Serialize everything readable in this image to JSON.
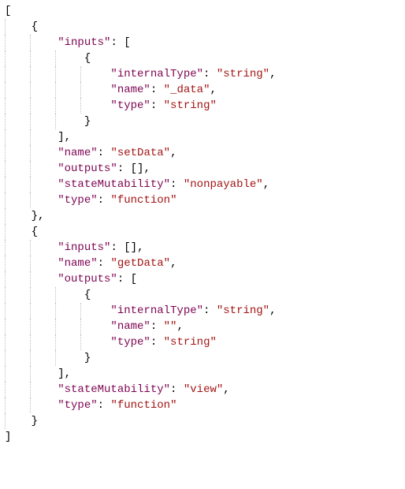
{
  "colors": {
    "key": "#7D0552",
    "string": "#A31515",
    "punct": "#000000",
    "brace": "#000000",
    "guide": "#c0c0c0"
  },
  "indentChar": "    ",
  "json_abi": [
    {
      "inputs": [
        {
          "internalType": "string",
          "name": "_data",
          "type": "string"
        }
      ],
      "name": "setData",
      "outputs": [],
      "stateMutability": "nonpayable",
      "type": "function"
    },
    {
      "inputs": [],
      "name": "getData",
      "outputs": [
        {
          "internalType": "string",
          "name": "",
          "type": "string"
        }
      ],
      "stateMutability": "view",
      "type": "function"
    }
  ],
  "lines": [
    {
      "indent": 0,
      "tokens": [
        {
          "t": "bracket",
          "v": "["
        }
      ]
    },
    {
      "indent": 1,
      "tokens": [
        {
          "t": "brace",
          "v": "{"
        }
      ]
    },
    {
      "indent": 2,
      "tokens": [
        {
          "t": "key",
          "v": "\"inputs\""
        },
        {
          "t": "punct",
          "v": ": "
        },
        {
          "t": "bracket",
          "v": "["
        }
      ]
    },
    {
      "indent": 3,
      "tokens": [
        {
          "t": "brace",
          "v": "{"
        }
      ]
    },
    {
      "indent": 4,
      "tokens": [
        {
          "t": "key",
          "v": "\"internalType\""
        },
        {
          "t": "punct",
          "v": ": "
        },
        {
          "t": "str",
          "v": "\"string\""
        },
        {
          "t": "punct",
          "v": ","
        }
      ]
    },
    {
      "indent": 4,
      "tokens": [
        {
          "t": "key",
          "v": "\"name\""
        },
        {
          "t": "punct",
          "v": ": "
        },
        {
          "t": "str",
          "v": "\"_data\""
        },
        {
          "t": "punct",
          "v": ","
        }
      ]
    },
    {
      "indent": 4,
      "tokens": [
        {
          "t": "key",
          "v": "\"type\""
        },
        {
          "t": "punct",
          "v": ": "
        },
        {
          "t": "str",
          "v": "\"string\""
        }
      ]
    },
    {
      "indent": 3,
      "tokens": [
        {
          "t": "brace",
          "v": "}"
        }
      ]
    },
    {
      "indent": 2,
      "tokens": [
        {
          "t": "bracket",
          "v": "]"
        },
        {
          "t": "punct",
          "v": ","
        }
      ]
    },
    {
      "indent": 2,
      "tokens": [
        {
          "t": "key",
          "v": "\"name\""
        },
        {
          "t": "punct",
          "v": ": "
        },
        {
          "t": "str",
          "v": "\"setData\""
        },
        {
          "t": "punct",
          "v": ","
        }
      ]
    },
    {
      "indent": 2,
      "tokens": [
        {
          "t": "key",
          "v": "\"outputs\""
        },
        {
          "t": "punct",
          "v": ": "
        },
        {
          "t": "bracket",
          "v": "[]"
        },
        {
          "t": "punct",
          "v": ","
        }
      ]
    },
    {
      "indent": 2,
      "tokens": [
        {
          "t": "key",
          "v": "\"stateMutability\""
        },
        {
          "t": "punct",
          "v": ": "
        },
        {
          "t": "str",
          "v": "\"nonpayable\""
        },
        {
          "t": "punct",
          "v": ","
        }
      ]
    },
    {
      "indent": 2,
      "tokens": [
        {
          "t": "key",
          "v": "\"type\""
        },
        {
          "t": "punct",
          "v": ": "
        },
        {
          "t": "str",
          "v": "\"function\""
        }
      ]
    },
    {
      "indent": 1,
      "tokens": [
        {
          "t": "brace",
          "v": "}"
        },
        {
          "t": "punct",
          "v": ","
        }
      ]
    },
    {
      "indent": 1,
      "tokens": [
        {
          "t": "brace",
          "v": "{"
        }
      ]
    },
    {
      "indent": 2,
      "tokens": [
        {
          "t": "key",
          "v": "\"inputs\""
        },
        {
          "t": "punct",
          "v": ": "
        },
        {
          "t": "bracket",
          "v": "[]"
        },
        {
          "t": "punct",
          "v": ","
        }
      ]
    },
    {
      "indent": 2,
      "tokens": [
        {
          "t": "key",
          "v": "\"name\""
        },
        {
          "t": "punct",
          "v": ": "
        },
        {
          "t": "str",
          "v": "\"getData\""
        },
        {
          "t": "punct",
          "v": ","
        }
      ]
    },
    {
      "indent": 2,
      "tokens": [
        {
          "t": "key",
          "v": "\"outputs\""
        },
        {
          "t": "punct",
          "v": ": "
        },
        {
          "t": "bracket",
          "v": "["
        }
      ]
    },
    {
      "indent": 3,
      "tokens": [
        {
          "t": "brace",
          "v": "{"
        }
      ]
    },
    {
      "indent": 4,
      "tokens": [
        {
          "t": "key",
          "v": "\"internalType\""
        },
        {
          "t": "punct",
          "v": ": "
        },
        {
          "t": "str",
          "v": "\"string\""
        },
        {
          "t": "punct",
          "v": ","
        }
      ]
    },
    {
      "indent": 4,
      "tokens": [
        {
          "t": "key",
          "v": "\"name\""
        },
        {
          "t": "punct",
          "v": ": "
        },
        {
          "t": "str",
          "v": "\"\""
        },
        {
          "t": "punct",
          "v": ","
        }
      ]
    },
    {
      "indent": 4,
      "tokens": [
        {
          "t": "key",
          "v": "\"type\""
        },
        {
          "t": "punct",
          "v": ": "
        },
        {
          "t": "str",
          "v": "\"string\""
        }
      ]
    },
    {
      "indent": 3,
      "tokens": [
        {
          "t": "brace",
          "v": "}"
        }
      ]
    },
    {
      "indent": 2,
      "tokens": [
        {
          "t": "bracket",
          "v": "]"
        },
        {
          "t": "punct",
          "v": ","
        }
      ]
    },
    {
      "indent": 2,
      "tokens": [
        {
          "t": "key",
          "v": "\"stateMutability\""
        },
        {
          "t": "punct",
          "v": ": "
        },
        {
          "t": "str",
          "v": "\"view\""
        },
        {
          "t": "punct",
          "v": ","
        }
      ]
    },
    {
      "indent": 2,
      "tokens": [
        {
          "t": "key",
          "v": "\"type\""
        },
        {
          "t": "punct",
          "v": ": "
        },
        {
          "t": "str",
          "v": "\"function\""
        }
      ]
    },
    {
      "indent": 1,
      "tokens": [
        {
          "t": "brace",
          "v": "}"
        }
      ]
    },
    {
      "indent": 0,
      "tokens": [
        {
          "t": "bracket",
          "v": "]"
        }
      ]
    }
  ]
}
